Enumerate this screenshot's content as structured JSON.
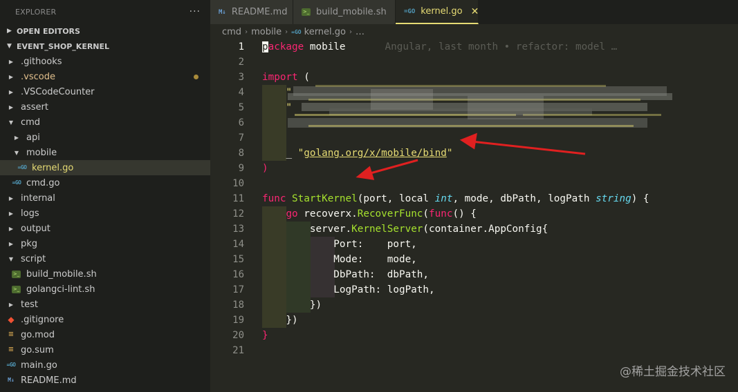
{
  "sidebar": {
    "title": "EXPLORER",
    "more_glyph": "···",
    "open_editors": "OPEN EDITORS",
    "project": "EVENT_SHOP_KERNEL",
    "items": [
      {
        "label": ".githooks",
        "kind": "folder",
        "depth": 1,
        "expanded": false
      },
      {
        "label": ".vscode",
        "kind": "folder",
        "depth": 1,
        "expanded": false,
        "modified": true
      },
      {
        "label": ".VSCodeCounter",
        "kind": "folder",
        "depth": 1,
        "expanded": false
      },
      {
        "label": "assert",
        "kind": "folder",
        "depth": 1,
        "expanded": false
      },
      {
        "label": "cmd",
        "kind": "folder",
        "depth": 1,
        "expanded": true
      },
      {
        "label": "api",
        "kind": "folder",
        "depth": 2,
        "expanded": false
      },
      {
        "label": "mobile",
        "kind": "folder",
        "depth": 2,
        "expanded": true
      },
      {
        "label": "kernel.go",
        "kind": "go",
        "depth": 3,
        "selected": true
      },
      {
        "label": "cmd.go",
        "kind": "go",
        "depth": 2
      },
      {
        "label": "internal",
        "kind": "folder",
        "depth": 1,
        "expanded": false
      },
      {
        "label": "logs",
        "kind": "folder",
        "depth": 1,
        "expanded": false
      },
      {
        "label": "output",
        "kind": "folder",
        "depth": 1,
        "expanded": false
      },
      {
        "label": "pkg",
        "kind": "folder",
        "depth": 1,
        "expanded": false
      },
      {
        "label": "script",
        "kind": "folder",
        "depth": 1,
        "expanded": true
      },
      {
        "label": "build_mobile.sh",
        "kind": "sh",
        "depth": 2
      },
      {
        "label": "golangci-lint.sh",
        "kind": "sh",
        "depth": 2
      },
      {
        "label": "test",
        "kind": "folder",
        "depth": 1,
        "expanded": false
      },
      {
        "label": ".gitignore",
        "kind": "git",
        "depth": 1
      },
      {
        "label": "go.mod",
        "kind": "mod",
        "depth": 1
      },
      {
        "label": "go.sum",
        "kind": "mod",
        "depth": 1
      },
      {
        "label": "main.go",
        "kind": "go",
        "depth": 1
      },
      {
        "label": "README.md",
        "kind": "md",
        "depth": 1
      }
    ]
  },
  "tabs": [
    {
      "label": "README.md",
      "icon": "M↓",
      "kind": "md",
      "active": false
    },
    {
      "label": "build_mobile.sh",
      "icon": ">_",
      "kind": "sh",
      "active": false
    },
    {
      "label": "kernel.go",
      "icon": "=GO",
      "kind": "go",
      "active": true,
      "close": "✕"
    }
  ],
  "breadcrumb": {
    "parts": [
      "cmd",
      "mobile"
    ],
    "file": "kernel.go",
    "go_icon": "=GO",
    "ellipsis": "…",
    "sep": "›"
  },
  "icons": {
    "go": "=GO",
    "sh": ">_",
    "md": "M↓",
    "git": "◆",
    "mod": "≡",
    "chev_right": "▶",
    "chev_down": "▼"
  },
  "editor": {
    "current_line": 1,
    "blame": "Angular, last month • refactor: model …",
    "lines": [
      [
        {
          "t": "p",
          "c": "cursor"
        },
        {
          "t": "ackage",
          "c": "kw"
        },
        {
          "t": " mobile",
          "c": "id"
        }
      ],
      [],
      [
        {
          "t": "import",
          "c": "kw"
        },
        {
          "t": " (",
          "c": "id"
        }
      ],
      [
        {
          "t": "\t\"",
          "c": "str"
        }
      ],
      [
        {
          "t": "\t\"",
          "c": "str"
        }
      ],
      [
        {
          "t": "\t",
          "c": "id"
        }
      ],
      [
        {
          "t": "\t",
          "c": "id"
        }
      ],
      [
        {
          "t": "\t",
          "c": "id"
        },
        {
          "t": "_",
          "c": "id"
        },
        {
          "t": " \"",
          "c": "str"
        },
        {
          "t": "golang.org/x/mobile/bind",
          "c": "str-link"
        },
        {
          "t": "\"",
          "c": "str"
        }
      ],
      [
        {
          "t": ")",
          "c": "kw"
        }
      ],
      [],
      [
        {
          "t": "func",
          "c": "kw"
        },
        {
          "t": " ",
          "c": "id"
        },
        {
          "t": "StartKernel",
          "c": "fn"
        },
        {
          "t": "(port, local ",
          "c": "id"
        },
        {
          "t": "int",
          "c": "ty"
        },
        {
          "t": ", mode, dbPath, logPath ",
          "c": "id"
        },
        {
          "t": "string",
          "c": "ty"
        },
        {
          "t": ") {",
          "c": "id"
        }
      ],
      [
        {
          "t": "\t",
          "c": "id"
        },
        {
          "t": "go",
          "c": "kw"
        },
        {
          "t": " recoverx.",
          "c": "id"
        },
        {
          "t": "RecoverFunc",
          "c": "fn"
        },
        {
          "t": "(",
          "c": "id"
        },
        {
          "t": "func",
          "c": "kw"
        },
        {
          "t": "() {",
          "c": "id"
        }
      ],
      [
        {
          "t": "\t\tserver.",
          "c": "id"
        },
        {
          "t": "KernelServer",
          "c": "fn"
        },
        {
          "t": "(container.AppConfig{",
          "c": "id"
        }
      ],
      [
        {
          "t": "\t\t\tPort:    port,",
          "c": "id"
        }
      ],
      [
        {
          "t": "\t\t\tMode:    mode,",
          "c": "id"
        }
      ],
      [
        {
          "t": "\t\t\tDbPath:  dbPath,",
          "c": "id"
        }
      ],
      [
        {
          "t": "\t\t\tLogPath: logPath,",
          "c": "id"
        }
      ],
      [
        {
          "t": "\t\t})",
          "c": "id"
        }
      ],
      [
        {
          "t": "\t})",
          "c": "id"
        }
      ],
      [
        {
          "t": "}",
          "c": "kw"
        }
      ],
      []
    ],
    "indents": [
      0,
      0,
      0,
      1,
      1,
      1,
      1,
      1,
      0,
      0,
      0,
      1,
      2,
      3,
      3,
      3,
      3,
      2,
      1,
      0,
      0
    ]
  },
  "watermark": "@稀土掘金技术社区"
}
